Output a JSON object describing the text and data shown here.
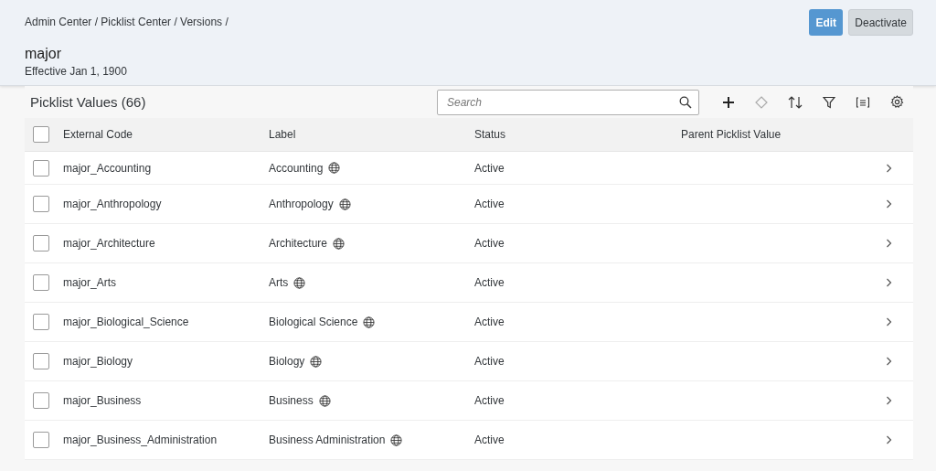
{
  "breadcrumb": "Admin Center / Picklist Center / Versions /",
  "title": "major",
  "subtitle": "Effective Jan 1, 1900",
  "actions": [
    {
      "label": "Edit",
      "kind": "primary"
    },
    {
      "label": "Deactivate",
      "kind": "secondary"
    }
  ],
  "table": {
    "title": "Picklist Values (66)",
    "search": {
      "placeholder": "Search"
    },
    "select_all": {
      "checked": false
    },
    "columns": [
      "External Code",
      "Label",
      "Status",
      "Parent Picklist Value"
    ],
    "rows": [
      {
        "external_code": "major_Accounting",
        "label": "Accounting",
        "status": "Active",
        "checked": false
      },
      {
        "external_code": "major_Anthropology",
        "label": "Anthropology",
        "status": "Active",
        "checked": false
      },
      {
        "external_code": "major_Architecture",
        "label": "Architecture",
        "status": "Active",
        "checked": false
      },
      {
        "external_code": "major_Arts",
        "label": "Arts",
        "status": "Active",
        "checked": false
      },
      {
        "external_code": "major_Biological_Science",
        "label": "Biological Science",
        "status": "Active",
        "checked": false
      },
      {
        "external_code": "major_Biology",
        "label": "Biology",
        "status": "Active",
        "checked": false
      },
      {
        "external_code": "major_Business",
        "label": "Business",
        "status": "Active",
        "checked": false
      },
      {
        "external_code": "major_Business_Administration",
        "label": "Business Administration",
        "status": "Active",
        "checked": false
      }
    ]
  }
}
